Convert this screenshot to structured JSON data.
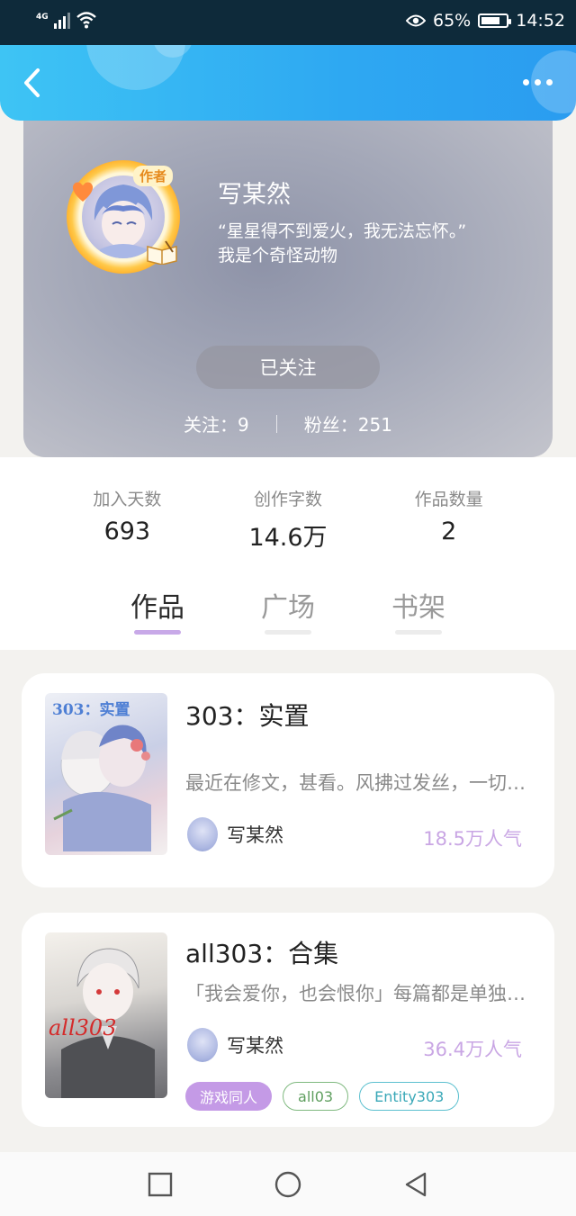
{
  "status_bar": {
    "network": "4G",
    "battery": "65%",
    "time": "14:52"
  },
  "header": {
    "back_icon": "chevron-left-icon",
    "more_icon": "more-dots-icon"
  },
  "profile": {
    "badge": "作者",
    "name": "写某然",
    "bio_line1": "“星星得不到爱火，我无法忘怀。”",
    "bio_line2": "我是个奇怪动物",
    "follow_label": "已关注",
    "following": "关注：9",
    "fans": "粉丝：251"
  },
  "stats": [
    {
      "label": "加入天数",
      "value": "693"
    },
    {
      "label": "创作字数",
      "value": "14.6万"
    },
    {
      "label": "作品数量",
      "value": "2"
    }
  ],
  "tabs": [
    {
      "label": "作品",
      "active": true
    },
    {
      "label": "广场",
      "active": false
    },
    {
      "label": "书架",
      "active": false
    }
  ],
  "books": [
    {
      "cover_text": "303：实置",
      "title": "303：实置",
      "desc": "最近在修文，甚看。风拂过发丝，一切都好像",
      "author": "写某然",
      "popularity": "18.5万人气"
    },
    {
      "cover_text": "all303",
      "title": "all303：合集",
      "desc": "「我会爱你，也会恨你」每篇都是单独的故事",
      "author": "写某然",
      "popularity": "36.4万人气",
      "tags": [
        {
          "label": "游戏同人",
          "color": "#c49ae6"
        },
        {
          "label": "all03",
          "color": "#7fb97f"
        },
        {
          "label": "Entity303",
          "color": "#5cc0cf"
        }
      ]
    }
  ],
  "colors": {
    "header": "#2ea8f2",
    "accent": "#c8a9e8",
    "popularity": "#c9a6e4"
  }
}
